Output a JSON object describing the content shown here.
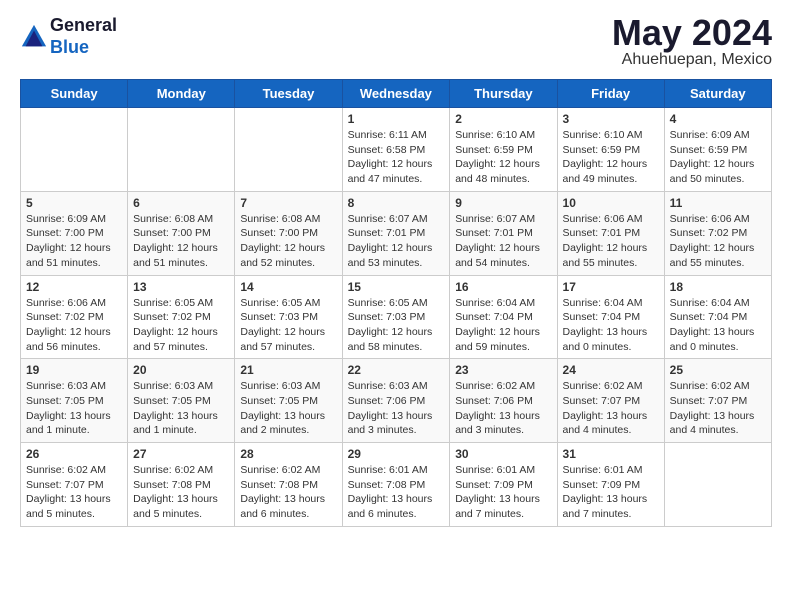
{
  "header": {
    "logo_line1": "General",
    "logo_line2": "Blue",
    "title": "May 2024",
    "subtitle": "Ahuehuepan, Mexico"
  },
  "calendar": {
    "days_of_week": [
      "Sunday",
      "Monday",
      "Tuesday",
      "Wednesday",
      "Thursday",
      "Friday",
      "Saturday"
    ],
    "weeks": [
      [
        {
          "day": "",
          "info": ""
        },
        {
          "day": "",
          "info": ""
        },
        {
          "day": "",
          "info": ""
        },
        {
          "day": "1",
          "info": "Sunrise: 6:11 AM\nSunset: 6:58 PM\nDaylight: 12 hours\nand 47 minutes."
        },
        {
          "day": "2",
          "info": "Sunrise: 6:10 AM\nSunset: 6:59 PM\nDaylight: 12 hours\nand 48 minutes."
        },
        {
          "day": "3",
          "info": "Sunrise: 6:10 AM\nSunset: 6:59 PM\nDaylight: 12 hours\nand 49 minutes."
        },
        {
          "day": "4",
          "info": "Sunrise: 6:09 AM\nSunset: 6:59 PM\nDaylight: 12 hours\nand 50 minutes."
        }
      ],
      [
        {
          "day": "5",
          "info": "Sunrise: 6:09 AM\nSunset: 7:00 PM\nDaylight: 12 hours\nand 51 minutes."
        },
        {
          "day": "6",
          "info": "Sunrise: 6:08 AM\nSunset: 7:00 PM\nDaylight: 12 hours\nand 51 minutes."
        },
        {
          "day": "7",
          "info": "Sunrise: 6:08 AM\nSunset: 7:00 PM\nDaylight: 12 hours\nand 52 minutes."
        },
        {
          "day": "8",
          "info": "Sunrise: 6:07 AM\nSunset: 7:01 PM\nDaylight: 12 hours\nand 53 minutes."
        },
        {
          "day": "9",
          "info": "Sunrise: 6:07 AM\nSunset: 7:01 PM\nDaylight: 12 hours\nand 54 minutes."
        },
        {
          "day": "10",
          "info": "Sunrise: 6:06 AM\nSunset: 7:01 PM\nDaylight: 12 hours\nand 55 minutes."
        },
        {
          "day": "11",
          "info": "Sunrise: 6:06 AM\nSunset: 7:02 PM\nDaylight: 12 hours\nand 55 minutes."
        }
      ],
      [
        {
          "day": "12",
          "info": "Sunrise: 6:06 AM\nSunset: 7:02 PM\nDaylight: 12 hours\nand 56 minutes."
        },
        {
          "day": "13",
          "info": "Sunrise: 6:05 AM\nSunset: 7:02 PM\nDaylight: 12 hours\nand 57 minutes."
        },
        {
          "day": "14",
          "info": "Sunrise: 6:05 AM\nSunset: 7:03 PM\nDaylight: 12 hours\nand 57 minutes."
        },
        {
          "day": "15",
          "info": "Sunrise: 6:05 AM\nSunset: 7:03 PM\nDaylight: 12 hours\nand 58 minutes."
        },
        {
          "day": "16",
          "info": "Sunrise: 6:04 AM\nSunset: 7:04 PM\nDaylight: 12 hours\nand 59 minutes."
        },
        {
          "day": "17",
          "info": "Sunrise: 6:04 AM\nSunset: 7:04 PM\nDaylight: 13 hours\nand 0 minutes."
        },
        {
          "day": "18",
          "info": "Sunrise: 6:04 AM\nSunset: 7:04 PM\nDaylight: 13 hours\nand 0 minutes."
        }
      ],
      [
        {
          "day": "19",
          "info": "Sunrise: 6:03 AM\nSunset: 7:05 PM\nDaylight: 13 hours\nand 1 minute."
        },
        {
          "day": "20",
          "info": "Sunrise: 6:03 AM\nSunset: 7:05 PM\nDaylight: 13 hours\nand 1 minute."
        },
        {
          "day": "21",
          "info": "Sunrise: 6:03 AM\nSunset: 7:05 PM\nDaylight: 13 hours\nand 2 minutes."
        },
        {
          "day": "22",
          "info": "Sunrise: 6:03 AM\nSunset: 7:06 PM\nDaylight: 13 hours\nand 3 minutes."
        },
        {
          "day": "23",
          "info": "Sunrise: 6:02 AM\nSunset: 7:06 PM\nDaylight: 13 hours\nand 3 minutes."
        },
        {
          "day": "24",
          "info": "Sunrise: 6:02 AM\nSunset: 7:07 PM\nDaylight: 13 hours\nand 4 minutes."
        },
        {
          "day": "25",
          "info": "Sunrise: 6:02 AM\nSunset: 7:07 PM\nDaylight: 13 hours\nand 4 minutes."
        }
      ],
      [
        {
          "day": "26",
          "info": "Sunrise: 6:02 AM\nSunset: 7:07 PM\nDaylight: 13 hours\nand 5 minutes."
        },
        {
          "day": "27",
          "info": "Sunrise: 6:02 AM\nSunset: 7:08 PM\nDaylight: 13 hours\nand 5 minutes."
        },
        {
          "day": "28",
          "info": "Sunrise: 6:02 AM\nSunset: 7:08 PM\nDaylight: 13 hours\nand 6 minutes."
        },
        {
          "day": "29",
          "info": "Sunrise: 6:01 AM\nSunset: 7:08 PM\nDaylight: 13 hours\nand 6 minutes."
        },
        {
          "day": "30",
          "info": "Sunrise: 6:01 AM\nSunset: 7:09 PM\nDaylight: 13 hours\nand 7 minutes."
        },
        {
          "day": "31",
          "info": "Sunrise: 6:01 AM\nSunset: 7:09 PM\nDaylight: 13 hours\nand 7 minutes."
        },
        {
          "day": "",
          "info": ""
        }
      ]
    ]
  }
}
